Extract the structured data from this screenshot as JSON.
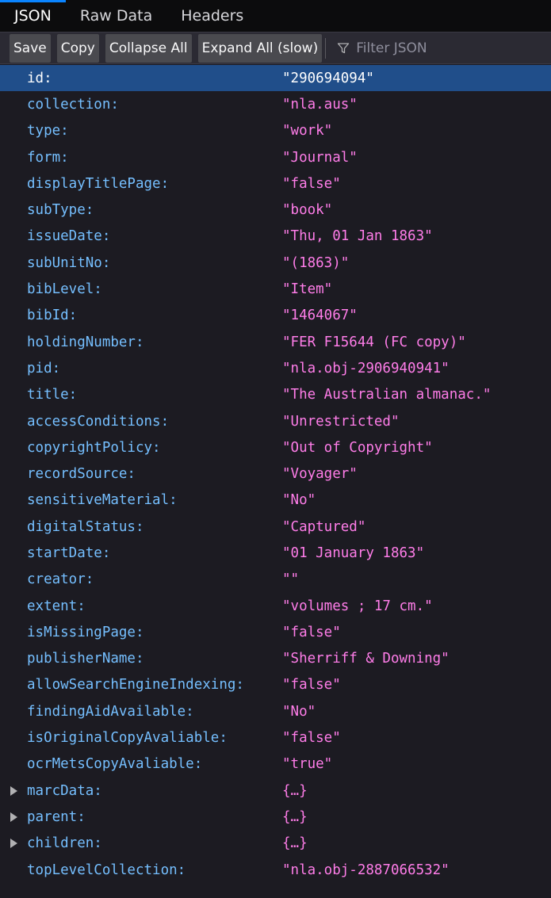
{
  "tabs": [
    {
      "label": "JSON"
    },
    {
      "label": "Raw Data"
    },
    {
      "label": "Headers"
    }
  ],
  "toolbar": {
    "save_label": "Save",
    "copy_label": "Copy",
    "collapse_label": "Collapse All",
    "expand_label": "Expand All (slow)",
    "filter_placeholder": "Filter JSON",
    "filter_icon": "funnel-icon"
  },
  "colors": {
    "key": "#75bfff",
    "string_value": "#ff7de9",
    "selected_row": "#204e8a",
    "tab_accent": "#0a84ff"
  },
  "rows": [
    {
      "key": "id:",
      "value": "\"290694094\""
    },
    {
      "key": "collection:",
      "value": "\"nla.aus\""
    },
    {
      "key": "type:",
      "value": "\"work\""
    },
    {
      "key": "form:",
      "value": "\"Journal\""
    },
    {
      "key": "displayTitlePage:",
      "value": "\"false\""
    },
    {
      "key": "subType:",
      "value": "\"book\""
    },
    {
      "key": "issueDate:",
      "value": "\"Thu, 01 Jan 1863\""
    },
    {
      "key": "subUnitNo:",
      "value": "\"(1863)\""
    },
    {
      "key": "bibLevel:",
      "value": "\"Item\""
    },
    {
      "key": "bibId:",
      "value": "\"1464067\""
    },
    {
      "key": "holdingNumber:",
      "value": "\"FER F15644 (FC copy)\""
    },
    {
      "key": "pid:",
      "value": "\"nla.obj-2906940941\""
    },
    {
      "key": "title:",
      "value": "\"The Australian almanac.\""
    },
    {
      "key": "accessConditions:",
      "value": "\"Unrestricted\""
    },
    {
      "key": "copyrightPolicy:",
      "value": "\"Out of Copyright\""
    },
    {
      "key": "recordSource:",
      "value": "\"Voyager\""
    },
    {
      "key": "sensitiveMaterial:",
      "value": "\"No\""
    },
    {
      "key": "digitalStatus:",
      "value": "\"Captured\""
    },
    {
      "key": "startDate:",
      "value": "\"01 January 1863\""
    },
    {
      "key": "creator:",
      "value": "\"\""
    },
    {
      "key": "extent:",
      "value": "\"volumes ; 17 cm.\""
    },
    {
      "key": "isMissingPage:",
      "value": "\"false\""
    },
    {
      "key": "publisherName:",
      "value": "\"Sherriff & Downing\""
    },
    {
      "key": "allowSearchEngineIndexing:",
      "value": "\"false\""
    },
    {
      "key": "findingAidAvailable:",
      "value": "\"No\""
    },
    {
      "key": "isOriginalCopyAvaliable:",
      "value": "\"false\""
    },
    {
      "key": "ocrMetsCopyAvaliable:",
      "value": "\"true\""
    },
    {
      "key": "marcData:",
      "value": "{…}"
    },
    {
      "key": "parent:",
      "value": "{…}"
    },
    {
      "key": "children:",
      "value": "{…}"
    },
    {
      "key": "topLevelCollection:",
      "value": "\"nla.obj-2887066532\""
    }
  ]
}
